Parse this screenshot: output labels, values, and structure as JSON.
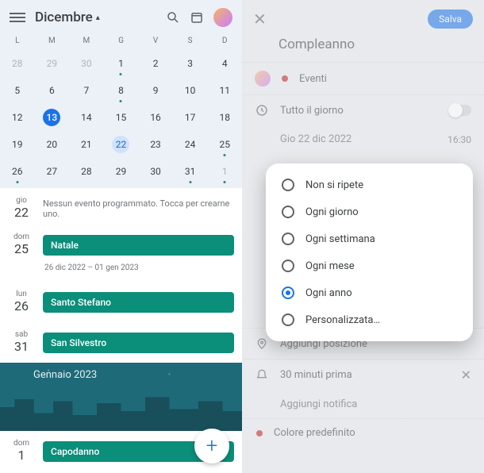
{
  "left": {
    "month_label": "Dicembre",
    "weekdays": [
      "L",
      "M",
      "M",
      "G",
      "V",
      "S",
      "D"
    ],
    "days": [
      {
        "n": "28",
        "other": true
      },
      {
        "n": "29",
        "other": true
      },
      {
        "n": "30",
        "other": true
      },
      {
        "n": "1",
        "dot": true
      },
      {
        "n": "2"
      },
      {
        "n": "3"
      },
      {
        "n": "4"
      },
      {
        "n": "5"
      },
      {
        "n": "6"
      },
      {
        "n": "7"
      },
      {
        "n": "8",
        "dot": true
      },
      {
        "n": "9"
      },
      {
        "n": "10"
      },
      {
        "n": "11"
      },
      {
        "n": "12"
      },
      {
        "n": "13",
        "today": true
      },
      {
        "n": "14"
      },
      {
        "n": "15"
      },
      {
        "n": "16"
      },
      {
        "n": "17"
      },
      {
        "n": "18"
      },
      {
        "n": "19"
      },
      {
        "n": "20"
      },
      {
        "n": "21"
      },
      {
        "n": "22",
        "sel": true
      },
      {
        "n": "23"
      },
      {
        "n": "24"
      },
      {
        "n": "25",
        "dot": true
      },
      {
        "n": "26",
        "dot": true
      },
      {
        "n": "27"
      },
      {
        "n": "28"
      },
      {
        "n": "29"
      },
      {
        "n": "30"
      },
      {
        "n": "31",
        "dot": true
      },
      {
        "n": "1",
        "other": true,
        "dot": true
      }
    ],
    "agenda": {
      "r1": {
        "dow": "gio",
        "dnum": "22",
        "text": "Nessun evento programmato. Tocca per crearne uno."
      },
      "r2": {
        "dow": "dom",
        "dnum": "25",
        "event": "Natale",
        "range": "26 dic 2022 – 01 gen 2023"
      },
      "r3": {
        "dow": "lun",
        "dnum": "26",
        "event": "Santo Stefano"
      },
      "r4": {
        "dow": "sab",
        "dnum": "31",
        "event": "San Silvestro"
      },
      "banner_title": "Gennaio 2023",
      "r5": {
        "dow": "dom",
        "dnum": "1",
        "event": "Capodanno"
      }
    }
  },
  "right": {
    "save": "Salva",
    "title": "Compleanno",
    "calendar_label": "Eventi",
    "allday_label": "Tutto il giorno",
    "date_text": "Gio 22 dic 2022",
    "time_text": "16:30",
    "options": {
      "o0": "Non si ripete",
      "o1": "Ogni giorno",
      "o2": "Ogni settimana",
      "o3": "Ogni mese",
      "o4": "Ogni anno",
      "o5": "Personalizzata…",
      "selected_index": 4
    },
    "location": "Aggiungi posizione",
    "reminder": "30 minuti prima",
    "add_notif": "Aggiungi notifica",
    "color": "Colore predefinito"
  }
}
